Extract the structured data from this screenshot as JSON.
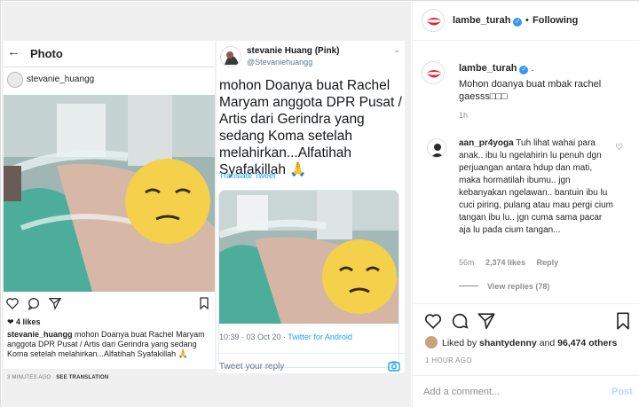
{
  "instagram_shot": {
    "title": "Photo",
    "username": "stevanie_huangg",
    "likes": "❤ 4 likes",
    "caption_user": "stevanie_huangg",
    "caption_text": " mohon Doanya buat Rachel Maryam anggota DPR Pusat / Artis dari Gerindra yang sedang Koma setelah melahirkan...Alfatihah Syafakillah 🙏",
    "time": "3 MINUTES AGO",
    "translation": "SEE TRANSLATION"
  },
  "twitter_shot": {
    "name": "stevanie Huang (Pink)",
    "handle": "@Stevaniehuangg",
    "tweet": "mohon Doanya buat Rachel Maryam anggota DPR Pusat / Artis dari Gerindra yang sedang Koma setelah melahirkan...Alfatihah Syafakillah 🙏",
    "translate": "Translate Tweet",
    "time": "10:39 · 03 Oct 20 · ",
    "client": "Twitter for Android",
    "reply_placeholder": "Tweet your reply"
  },
  "header": {
    "username": "lambe_turah",
    "dot": "•",
    "follow_status": "Following"
  },
  "post": {
    "username": "lambe_turah",
    "dot": ".",
    "text": "Mohon doanya buat mbak rachel gaesss□□□",
    "time": "1h"
  },
  "comment": {
    "username": "aan_pr4yoga",
    "text": " Tuh lihat wahai para anak.. ibu lu ngelahirin lu penuh dgn perjuangan antara hdup dan mati, maka hormatilah ibumu.. jgn kebanyakan ngelawan.. bantuin ibu lu cuci piring, pulang atau mau pergi cium tangan ibu lu.. jgn cuma sama pacar aja lu pada cium tangan...",
    "time": "56m",
    "likes": "2,374 likes",
    "reply": "Reply",
    "view_replies": "View replies (78)"
  },
  "liked_by": {
    "prefix": "Liked by ",
    "user": "shantydenny",
    "middle": " and ",
    "others": "96,474 others"
  },
  "post_age": "1 HOUR AGO",
  "comment_box": {
    "placeholder": "Add a comment...",
    "post_label": "Post"
  },
  "colors": {
    "accent_blue": "#3897f0",
    "twitter_blue": "#1da1f2",
    "verified": "#3897f0",
    "post_disabled": "#b3dbff"
  }
}
